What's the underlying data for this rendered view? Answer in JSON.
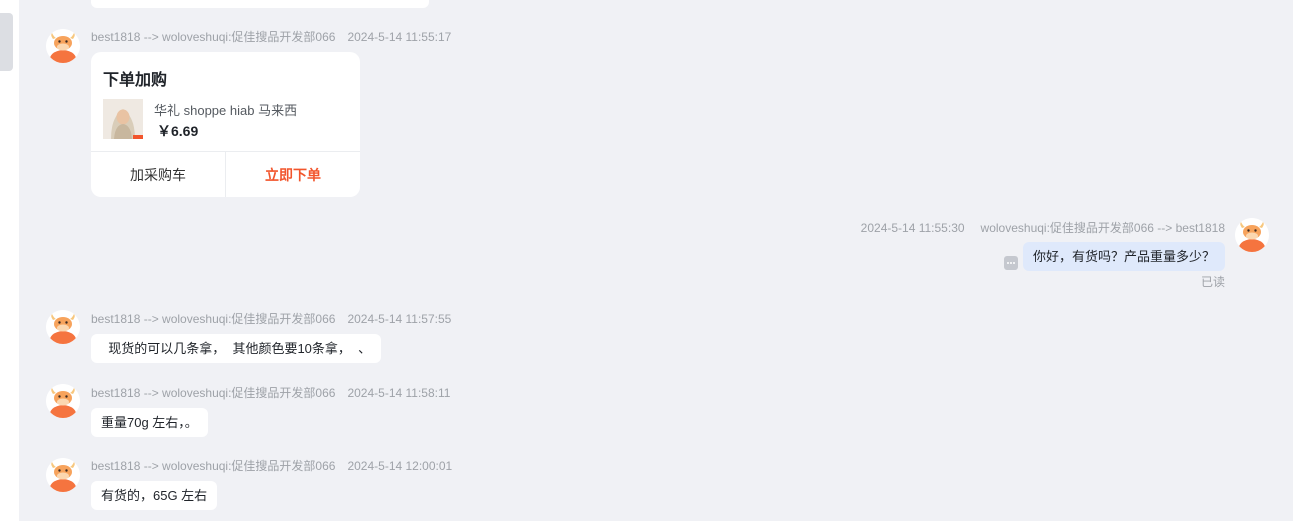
{
  "messages": [
    {
      "sender": "best1818 --> woloveshuqi:促佳搜品开发部066",
      "time": "2024-5-14 11:55:17",
      "type": "order_card",
      "card": {
        "title": "下单加购",
        "product_name": "华礼 shoppe hiab 马来西",
        "price": "￥6.69",
        "cart_button": "加采购车",
        "buy_button": "立即下单"
      }
    },
    {
      "sender": "woloveshuqi:促佳搜品开发部066 --> best1818",
      "time": "2024-5-14 11:55:30",
      "type": "text",
      "text": "你好，有货吗？产品重量多少？",
      "read_status": "已读"
    },
    {
      "sender": "best1818 --> woloveshuqi:促佳搜品开发部066",
      "time": "2024-5-14 11:57:55",
      "type": "text",
      "text": "  现货的可以几条拿，  其他颜色要10条拿，  、"
    },
    {
      "sender": "best1818 --> woloveshuqi:促佳搜品开发部066",
      "time": "2024-5-14 11:58:11",
      "type": "text",
      "text": "重量70g 左右，。"
    },
    {
      "sender": "best1818 --> woloveshuqi:促佳搜品开发部066",
      "time": "2024-5-14 12:00:01",
      "type": "text",
      "text": "有货的，65G 左右"
    }
  ],
  "icons": {
    "avatar": "cartoon-bull-avatar-icon",
    "more": "more-options-icon"
  },
  "colors": {
    "chat_background": "#f0f1f5",
    "my_bubble": "#dfe9fb",
    "buy_accent": "#f2552c",
    "avatar_accent": "#f5743f"
  }
}
